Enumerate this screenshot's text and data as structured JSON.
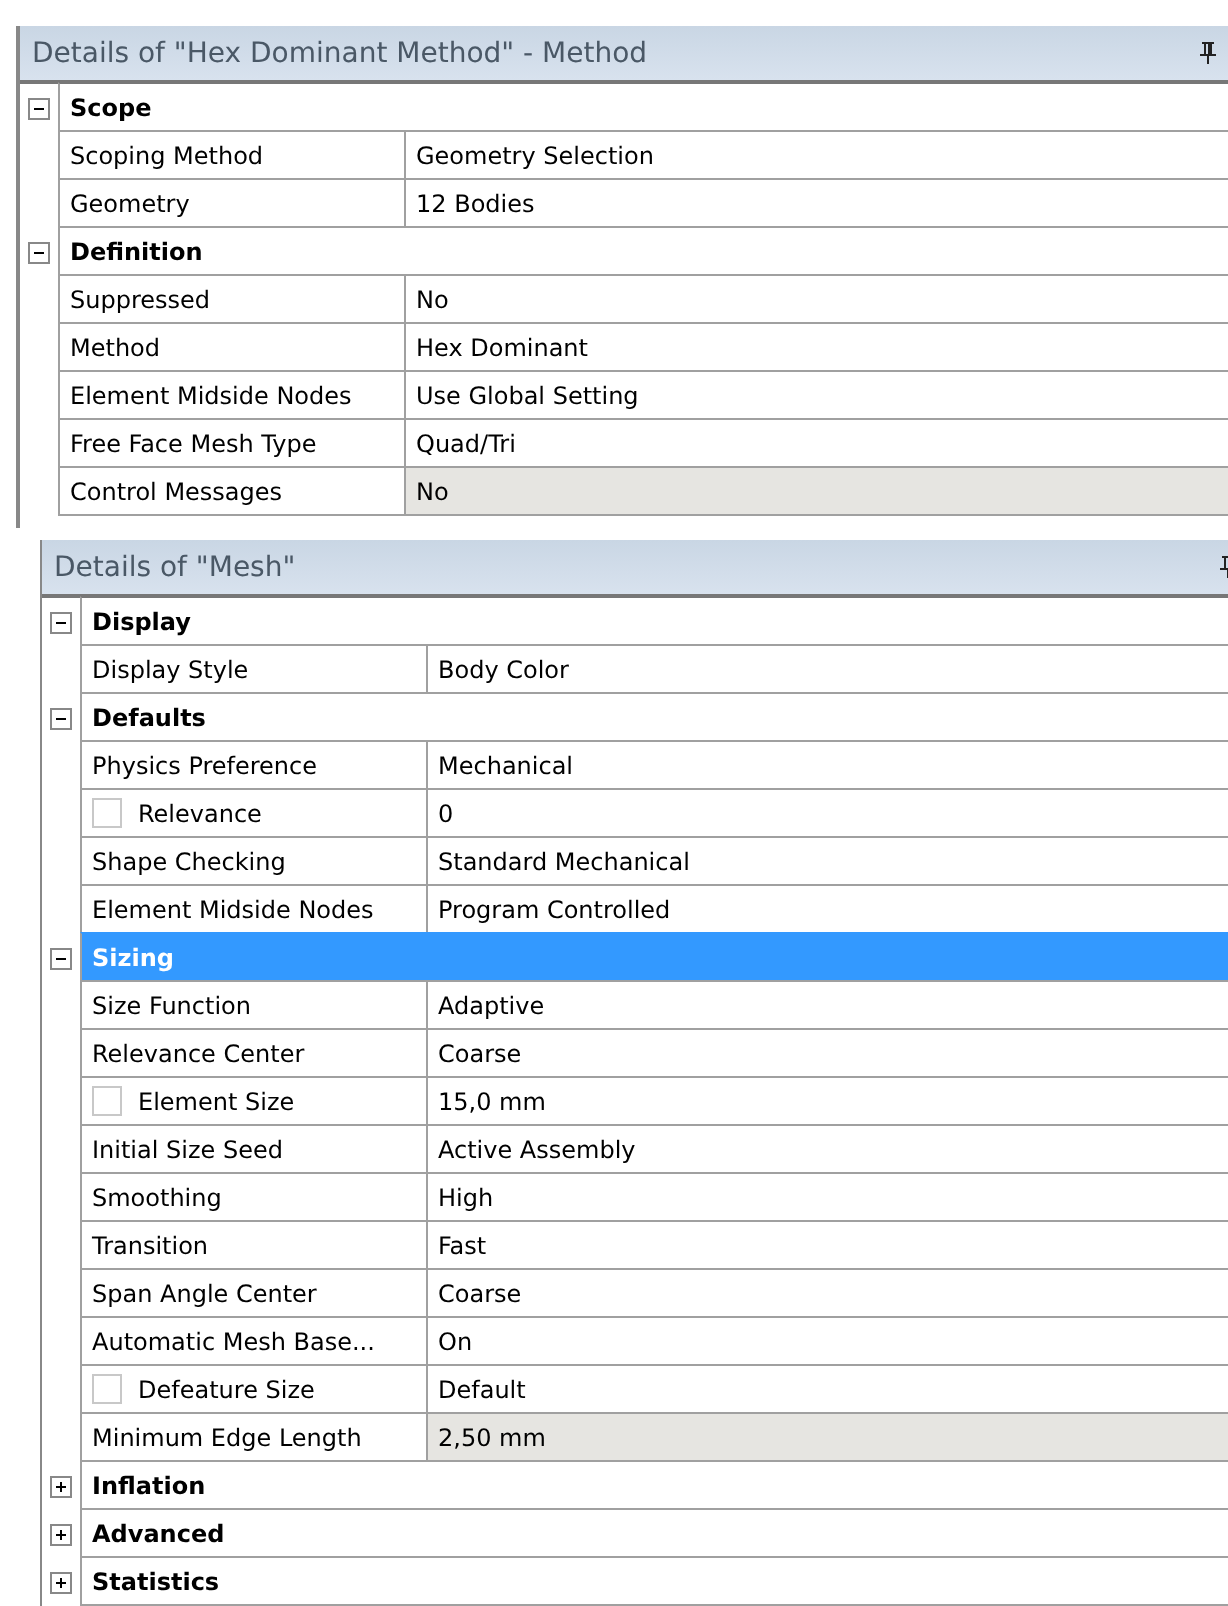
{
  "panels": [
    {
      "title": "Details of \"Hex Dominant Method\" - Method",
      "groups": [
        {
          "name": "Scope",
          "expanded": true,
          "selected": false,
          "rows": [
            {
              "kind": "plain",
              "label": "Scoping Method",
              "value": "Geometry Selection",
              "readonly": false
            },
            {
              "kind": "plain",
              "label": "Geometry",
              "value": "12 Bodies",
              "readonly": false
            }
          ]
        },
        {
          "name": "Definition",
          "expanded": true,
          "selected": false,
          "rows": [
            {
              "kind": "plain",
              "label": "Suppressed",
              "value": "No",
              "readonly": false
            },
            {
              "kind": "plain",
              "label": "Method",
              "value": "Hex Dominant",
              "readonly": false
            },
            {
              "kind": "plain",
              "label": "Element Midside Nodes",
              "value": "Use Global Setting",
              "readonly": false
            },
            {
              "kind": "plain",
              "label": "Free Face Mesh Type",
              "value": "Quad/Tri",
              "readonly": false
            },
            {
              "kind": "plain",
              "label": "Control Messages",
              "value": "No",
              "readonly": true
            }
          ]
        }
      ]
    },
    {
      "title": "Details of \"Mesh\"",
      "groups": [
        {
          "name": "Display",
          "expanded": true,
          "selected": false,
          "rows": [
            {
              "kind": "plain",
              "label": "Display Style",
              "value": "Body Color",
              "readonly": false
            }
          ]
        },
        {
          "name": "Defaults",
          "expanded": true,
          "selected": false,
          "rows": [
            {
              "kind": "plain",
              "label": "Physics Preference",
              "value": "Mechanical",
              "readonly": false
            },
            {
              "kind": "checkbox",
              "label": "Relevance",
              "value": "0",
              "readonly": false,
              "checked": false
            },
            {
              "kind": "plain",
              "label": "Shape Checking",
              "value": "Standard Mechanical",
              "readonly": false
            },
            {
              "kind": "plain",
              "label": "Element Midside Nodes",
              "value": "Program Controlled",
              "readonly": false
            }
          ]
        },
        {
          "name": "Sizing",
          "expanded": true,
          "selected": true,
          "rows": [
            {
              "kind": "plain",
              "label": "Size Function",
              "value": "Adaptive",
              "readonly": false
            },
            {
              "kind": "plain",
              "label": "Relevance Center",
              "value": "Coarse",
              "readonly": false
            },
            {
              "kind": "checkbox",
              "label": "Element Size",
              "value": "15,0 mm",
              "readonly": false,
              "checked": false
            },
            {
              "kind": "plain",
              "label": "Initial Size Seed",
              "value": "Active Assembly",
              "readonly": false
            },
            {
              "kind": "plain",
              "label": "Smoothing",
              "value": "High",
              "readonly": false
            },
            {
              "kind": "plain",
              "label": "Transition",
              "value": "Fast",
              "readonly": false
            },
            {
              "kind": "plain",
              "label": "Span Angle Center",
              "value": "Coarse",
              "readonly": false
            },
            {
              "kind": "plain",
              "label": "Automatic Mesh Base...",
              "value": "On",
              "readonly": false
            },
            {
              "kind": "checkbox",
              "label": "Defeature Size",
              "value": "Default",
              "readonly": false,
              "checked": false
            },
            {
              "kind": "plain",
              "label": "Minimum Edge Length",
              "value": "2,50 mm",
              "readonly": true
            }
          ]
        },
        {
          "name": "Inflation",
          "expanded": false,
          "selected": false
        },
        {
          "name": "Advanced",
          "expanded": false,
          "selected": false
        },
        {
          "name": "Statistics",
          "expanded": false,
          "selected": false
        }
      ]
    }
  ]
}
